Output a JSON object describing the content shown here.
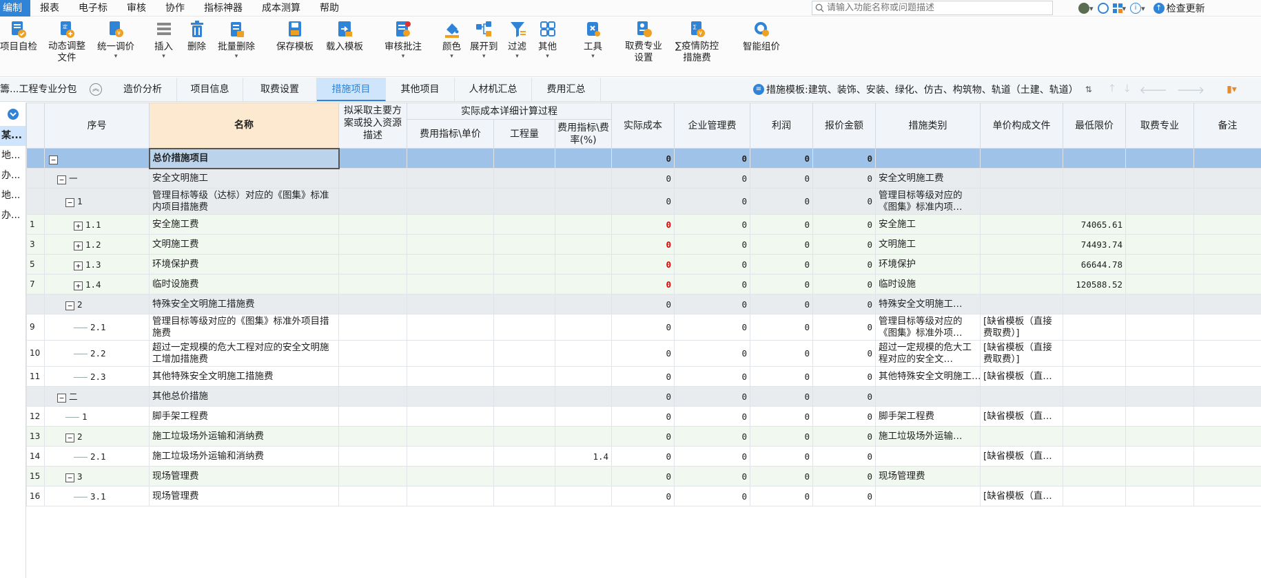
{
  "menu": {
    "items": [
      "编制",
      "报表",
      "电子标",
      "审核",
      "协作",
      "指标神器",
      "成本测算",
      "帮助"
    ],
    "active_label": "编制",
    "search_placeholder": "请输入功能名称或问题描述",
    "check_update": "检查更新"
  },
  "toolbar": {
    "buttons": [
      {
        "label": "项目自检",
        "icon": "check-icon"
      },
      {
        "label": "动态调整\n文件",
        "icon": "adjust-file-icon"
      },
      {
        "label": "统一调价",
        "icon": "price-icon"
      },
      {
        "label": "插入",
        "icon": "insert-icon"
      },
      {
        "label": "删除",
        "icon": "delete-icon"
      },
      {
        "label": "批量删除",
        "icon": "batch-delete-icon"
      },
      {
        "label": "保存模板",
        "icon": "save-template-icon"
      },
      {
        "label": "载入模板",
        "icon": "load-template-icon"
      },
      {
        "label": "审核批注",
        "icon": "review-icon"
      },
      {
        "label": "颜色",
        "icon": "color-icon"
      },
      {
        "label": "展开到",
        "icon": "expand-icon"
      },
      {
        "label": "过滤",
        "icon": "filter-icon"
      },
      {
        "label": "其他",
        "icon": "other-icon"
      },
      {
        "label": "工具",
        "icon": "tool-icon"
      },
      {
        "label": "取费专业\n设置",
        "icon": "fee-setting-icon"
      },
      {
        "label": "∑疫情防控\n措施费",
        "icon": "epidemic-icon"
      },
      {
        "label": "智能组价",
        "icon": "smart-price-icon"
      }
    ]
  },
  "tabs": {
    "left_label": "籌...工程专业分包",
    "items": [
      "造价分析",
      "项目信息",
      "取费设置",
      "措施项目",
      "其他项目",
      "人材机汇总",
      "费用汇总"
    ],
    "active": "措施项目",
    "template_info": "措施模板:建筑、装饰、安装、绿化、仿古、构筑物、轨道（土建、轨道）"
  },
  "leftnav": {
    "items": [
      "某...",
      "地...",
      "办...",
      "地...",
      "办..."
    ]
  },
  "grid": {
    "headers": {
      "seq": "序号",
      "name": "名称",
      "plan": "拟采取主要方案或投入资源描述",
      "detail_group": "实际成本详细计算过程",
      "fee_unit": "费用指标\\单价",
      "quantity": "工程量",
      "fee_rate": "费用指标\\费率(%)",
      "actual_cost": "实际成本",
      "mgmt_fee": "企业管理费",
      "profit": "利润",
      "quote": "报价金额",
      "category": "措施类别",
      "unit_file": "单价构成文件",
      "min_price": "最低限价",
      "fee_major": "取费专业",
      "remark": "备注"
    },
    "rows": [
      {
        "idx": "",
        "seq": "",
        "level": 0,
        "exp": "−",
        "name": "总价措施项目",
        "rate": "",
        "cost": "0",
        "mgmt": "0",
        "profit": "0",
        "quote": "0",
        "cat": "",
        "file": "",
        "min": "",
        "style": "sel"
      },
      {
        "idx": "",
        "seq": "一",
        "level": 1,
        "exp": "−",
        "name": "安全文明施工",
        "rate": "",
        "cost": "0",
        "mgmt": "0",
        "profit": "0",
        "quote": "0",
        "cat": "安全文明施工费",
        "file": "",
        "min": "",
        "style": "grey"
      },
      {
        "idx": "",
        "seq": "1",
        "level": 2,
        "exp": "−",
        "name": "管理目标等级（达标）对应的《图集》标准内项目措施费",
        "rate": "",
        "cost": "0",
        "mgmt": "0",
        "profit": "0",
        "quote": "0",
        "cat": "管理目标等级对应的《图集》标准内项…",
        "file": "",
        "min": "",
        "style": "grey",
        "tall": true
      },
      {
        "idx": "1",
        "seq": "1.1",
        "level": 3,
        "exp": "+",
        "name": "安全施工费",
        "rate": "",
        "cost": "0",
        "mgmt": "0",
        "profit": "0",
        "quote": "0",
        "cat": "安全施工",
        "file": "",
        "min": "74065.61",
        "style": "green",
        "red": true
      },
      {
        "idx": "3",
        "seq": "1.2",
        "level": 3,
        "exp": "+",
        "name": "文明施工费",
        "rate": "",
        "cost": "0",
        "mgmt": "0",
        "profit": "0",
        "quote": "0",
        "cat": "文明施工",
        "file": "",
        "min": "74493.74",
        "style": "green",
        "red": true
      },
      {
        "idx": "5",
        "seq": "1.3",
        "level": 3,
        "exp": "+",
        "name": "环境保护费",
        "rate": "",
        "cost": "0",
        "mgmt": "0",
        "profit": "0",
        "quote": "0",
        "cat": "环境保护",
        "file": "",
        "min": "66644.78",
        "style": "green",
        "red": true
      },
      {
        "idx": "7",
        "seq": "1.4",
        "level": 3,
        "exp": "+",
        "name": "临时设施费",
        "rate": "",
        "cost": "0",
        "mgmt": "0",
        "profit": "0",
        "quote": "0",
        "cat": "临时设施",
        "file": "",
        "min": "120588.52",
        "style": "green",
        "red": true
      },
      {
        "idx": "",
        "seq": "2",
        "level": 2,
        "exp": "−",
        "name": "特殊安全文明施工措施费",
        "rate": "",
        "cost": "0",
        "mgmt": "0",
        "profit": "0",
        "quote": "0",
        "cat": "特殊安全文明施工…",
        "file": "",
        "min": "",
        "style": "grey"
      },
      {
        "idx": "9",
        "seq": "2.1",
        "level": 3,
        "exp": "",
        "name": "管理目标等级对应的《图集》标准外项目措施费",
        "rate": "",
        "cost": "0",
        "mgmt": "0",
        "profit": "0",
        "quote": "0",
        "cat": "管理目标等级对应的《图集》标准外项…",
        "file": "[缺省模板（直接费取费）]",
        "min": "",
        "style": "white",
        "tall": true
      },
      {
        "idx": "10",
        "seq": "2.2",
        "level": 3,
        "exp": "",
        "name": "超过一定规模的危大工程对应的安全文明施工增加措施费",
        "rate": "",
        "cost": "0",
        "mgmt": "0",
        "profit": "0",
        "quote": "0",
        "cat": "超过一定规模的危大工程对应的安全文…",
        "file": "[缺省模板（直接费取费）]",
        "min": "",
        "style": "white",
        "tall": true
      },
      {
        "idx": "11",
        "seq": "2.3",
        "level": 3,
        "exp": "",
        "name": "其他特殊安全文明施工措施费",
        "rate": "",
        "cost": "0",
        "mgmt": "0",
        "profit": "0",
        "quote": "0",
        "cat": "其他特殊安全文明施工…",
        "file": "[缺省模板（直…",
        "min": "",
        "style": "white"
      },
      {
        "idx": "",
        "seq": "二",
        "level": 1,
        "exp": "−",
        "name": "其他总价措施",
        "rate": "",
        "cost": "0",
        "mgmt": "0",
        "profit": "0",
        "quote": "0",
        "cat": "",
        "file": "",
        "min": "",
        "style": "grey"
      },
      {
        "idx": "12",
        "seq": "1",
        "level": 2,
        "exp": "",
        "name": "脚手架工程费",
        "rate": "",
        "cost": "0",
        "mgmt": "0",
        "profit": "0",
        "quote": "0",
        "cat": "脚手架工程费",
        "file": "[缺省模板（直…",
        "min": "",
        "style": "white"
      },
      {
        "idx": "13",
        "seq": "2",
        "level": 2,
        "exp": "−",
        "name": "施工垃圾场外运输和消纳费",
        "rate": "",
        "cost": "0",
        "mgmt": "0",
        "profit": "0",
        "quote": "0",
        "cat": "施工垃圾场外运输…",
        "file": "",
        "min": "",
        "style": "green"
      },
      {
        "idx": "14",
        "seq": "2.1",
        "level": 3,
        "exp": "",
        "name": "施工垃圾场外运输和消纳费",
        "rate": "1.4",
        "cost": "0",
        "mgmt": "0",
        "profit": "0",
        "quote": "0",
        "cat": "",
        "file": "[缺省模板（直…",
        "min": "",
        "style": "white"
      },
      {
        "idx": "15",
        "seq": "3",
        "level": 2,
        "exp": "−",
        "name": "现场管理费",
        "rate": "",
        "cost": "0",
        "mgmt": "0",
        "profit": "0",
        "quote": "0",
        "cat": "现场管理费",
        "file": "",
        "min": "",
        "style": "green"
      },
      {
        "idx": "16",
        "seq": "3.1",
        "level": 3,
        "exp": "",
        "name": "现场管理费",
        "rate": "",
        "cost": "0",
        "mgmt": "0",
        "profit": "0",
        "quote": "0",
        "cat": "",
        "file": "[缺省模板（直…",
        "min": "",
        "style": "white"
      }
    ]
  },
  "colors": {
    "accent": "#2f84d8",
    "selected_row": "#9fc2e8",
    "group_row": "#e9ecef",
    "zebra_green": "#f0f8ef",
    "header_name": "#fde9cf",
    "red": "#e00000"
  }
}
